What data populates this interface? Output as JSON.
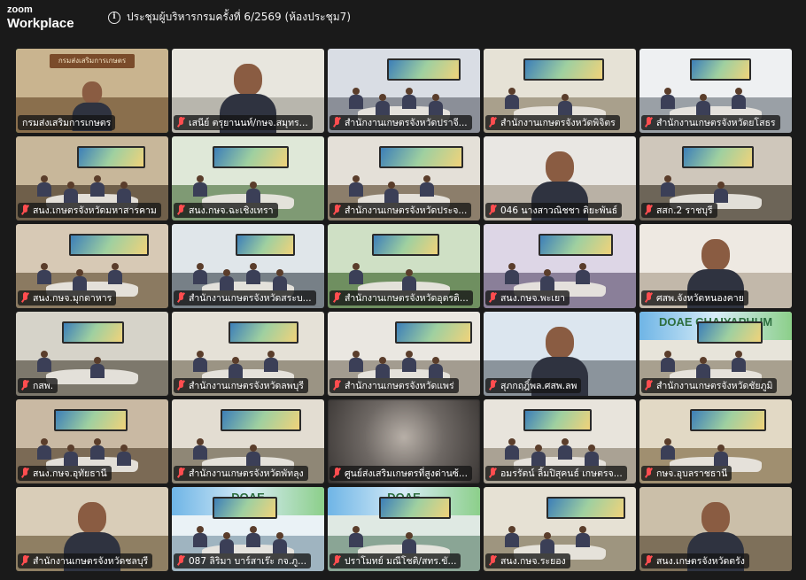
{
  "app": {
    "brand_top": "zoom",
    "brand_bottom": "Workplace"
  },
  "meeting": {
    "info_icon": "info-icon",
    "title": "ประชุมผู้บริหารกรมครั้งที่ 6/2569 (ห้องประชุม7)"
  },
  "colors": {
    "active_speaker": "#46d46a",
    "muted_mic": "#ff4d4f",
    "background": "#1a1a1a"
  },
  "participants": [
    {
      "name": "กรมส่งเสริมการเกษตร",
      "muted": false,
      "active": true,
      "scene": "podium",
      "wall_text": "กรมส่งเสริมการเกษตร"
    },
    {
      "name": "เสนีย์ ตรุยานนท์/กษจ.สมุทร...",
      "muted": true,
      "scene": "closeup"
    },
    {
      "name": "สำนักงานเกษตรจังหวัดปราจี...",
      "muted": true,
      "scene": "room"
    },
    {
      "name": "สำนักงานเกษตรจังหวัดพิจิตร",
      "muted": true,
      "scene": "room"
    },
    {
      "name": "สำนักงานเกษตรจังหวัดยโสธร",
      "muted": true,
      "scene": "room"
    },
    {
      "name": "สนง.เกษตรจังหวัดมหาสารคาม",
      "muted": true,
      "scene": "room"
    },
    {
      "name": "สนง.กษจ.ฉะเชิงเทรา",
      "muted": true,
      "scene": "room"
    },
    {
      "name": "สำนักงานเกษตรจังหวัดประจ...",
      "muted": true,
      "scene": "room"
    },
    {
      "name": "046 นางสาวณิชชา ติยะพันธ์",
      "muted": true,
      "scene": "closeup"
    },
    {
      "name": "สสก.2 ราชบุรี",
      "muted": true,
      "scene": "room"
    },
    {
      "name": "สนง.กษจ.มุกดาหาร",
      "muted": true,
      "scene": "room"
    },
    {
      "name": "สำนักงานเกษตรจังหวัดสระบ...",
      "muted": true,
      "scene": "room"
    },
    {
      "name": "สำนักงานเกษตรจังหวัดอุตรดิ...",
      "muted": true,
      "scene": "room"
    },
    {
      "name": "สนง.กษจ.พะเยา",
      "muted": true,
      "scene": "room"
    },
    {
      "name": "ศสพ.จังหวัดหนองคาย",
      "muted": true,
      "scene": "closeup"
    },
    {
      "name": "กสพ.",
      "muted": true,
      "scene": "room"
    },
    {
      "name": "สำนักงานเกษตรจังหวัดลพบุรี",
      "muted": true,
      "scene": "room"
    },
    {
      "name": "สำนักงานเกษตรจังหวัดแพร่",
      "muted": true,
      "scene": "room"
    },
    {
      "name": "สุภกฤฎิ์พล.ศสพ.ลพ",
      "muted": true,
      "scene": "closeup"
    },
    {
      "name": "สำนักงานเกษตรจังหวัดชัยภูมิ",
      "muted": true,
      "scene": "banner",
      "banner_text": "DOAE CHAIYAPHUM"
    },
    {
      "name": "สนง.กษจ.อุทัยธานี",
      "muted": true,
      "scene": "room"
    },
    {
      "name": "สำนักงานเกษตรจังหวัดพัทลุง",
      "muted": true,
      "scene": "room"
    },
    {
      "name": "ศูนย์ส่งเสริมเกษตรที่สูงด่านซ้...",
      "muted": true,
      "scene": "blur"
    },
    {
      "name": "อมรรัตน์ ลิ้มปิสุคนธ์ เกษตรจ...",
      "muted": true,
      "scene": "room"
    },
    {
      "name": "กษจ.อุบลราชธานี",
      "muted": true,
      "scene": "room"
    },
    {
      "name": "สำนักงานเกษตรจังหวัดชลบุรี",
      "muted": true,
      "scene": "closeup"
    },
    {
      "name": "087 ลิริมา บาร์สาเร๊ะ กจ.ภู...",
      "muted": true,
      "scene": "banner",
      "banner_text": "DOAE"
    },
    {
      "name": "ปราโมทย์ มณีโชติ/สทร.ขั...",
      "muted": true,
      "scene": "banner",
      "banner_text": "DOAE"
    },
    {
      "name": "สนง.กษจ.ระยอง",
      "muted": true,
      "scene": "room"
    },
    {
      "name": "สนง.เกษตรจังหวัดตรัง",
      "muted": true,
      "scene": "closeup"
    }
  ]
}
